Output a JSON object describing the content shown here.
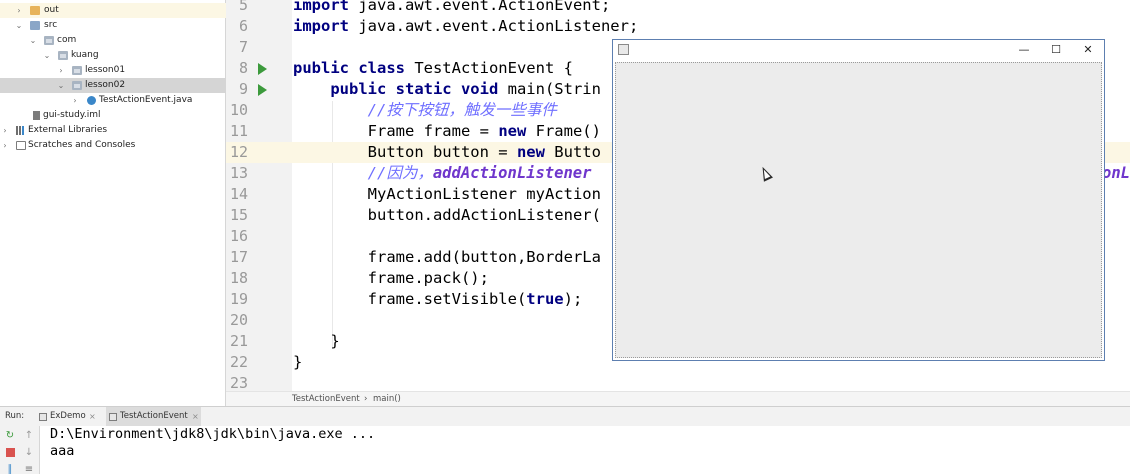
{
  "project_tree": {
    "items": [
      {
        "label": "out",
        "icon": "folder-orange-icon"
      },
      {
        "label": "src",
        "icon": "source-folder-icon"
      },
      {
        "label": "com",
        "icon": "package-icon"
      },
      {
        "label": "kuang",
        "icon": "package-icon"
      },
      {
        "label": "lesson01",
        "icon": "package-icon"
      },
      {
        "label": "lesson02",
        "icon": "package-icon"
      },
      {
        "label": "TestActionEvent.java",
        "icon": "java-class-icon"
      },
      {
        "label": "gui-study.iml",
        "icon": "iml-file-icon"
      },
      {
        "label": "External Libraries",
        "icon": "libraries-icon"
      },
      {
        "label": "Scratches and Consoles",
        "icon": "scratches-icon"
      }
    ]
  },
  "editor": {
    "current_line": 12,
    "lines": [
      {
        "num": "5",
        "segments": [
          {
            "t": "import",
            "c": "kw"
          },
          {
            "t": " java.awt.event.ActionEvent;",
            "c": ""
          }
        ]
      },
      {
        "num": "6",
        "segments": [
          {
            "t": "import",
            "c": "kw"
          },
          {
            "t": " java.awt.event.ActionListener;",
            "c": ""
          }
        ]
      },
      {
        "num": "7",
        "segments": []
      },
      {
        "num": "8",
        "segments": [
          {
            "t": "public class",
            "c": "kw"
          },
          {
            "t": " TestActionEvent {",
            "c": ""
          }
        ]
      },
      {
        "num": "9",
        "segments": [
          {
            "t": "    ",
            "c": ""
          },
          {
            "t": "public static void",
            "c": "kw"
          },
          {
            "t": " main(Strin",
            "c": ""
          }
        ]
      },
      {
        "num": "10",
        "segments": [
          {
            "t": "        ",
            "c": ""
          },
          {
            "t": "//按下按钮，触发一些事件",
            "c": "cm"
          }
        ]
      },
      {
        "num": "11",
        "segments": [
          {
            "t": "        Frame frame = ",
            "c": ""
          },
          {
            "t": "new",
            "c": "kw"
          },
          {
            "t": " Frame()",
            "c": ""
          }
        ]
      },
      {
        "num": "12",
        "segments": [
          {
            "t": "        Button button = ",
            "c": ""
          },
          {
            "t": "new",
            "c": "kw"
          },
          {
            "t": " Butto",
            "c": ""
          }
        ]
      },
      {
        "num": "13",
        "segments": [
          {
            "t": "        ",
            "c": ""
          },
          {
            "t": "//因为，",
            "c": "cm"
          },
          {
            "t": "addActionListener",
            "c": "cm-b"
          }
        ]
      },
      {
        "num": "14",
        "segments": [
          {
            "t": "        MyActionListener myAction",
            "c": ""
          }
        ]
      },
      {
        "num": "15",
        "segments": [
          {
            "t": "        button.addActionListener(",
            "c": ""
          }
        ]
      },
      {
        "num": "16",
        "segments": []
      },
      {
        "num": "17",
        "segments": [
          {
            "t": "        frame.add(button,BorderLa",
            "c": ""
          }
        ]
      },
      {
        "num": "18",
        "segments": [
          {
            "t": "        frame.pack();",
            "c": ""
          }
        ]
      },
      {
        "num": "19",
        "segments": [
          {
            "t": "        frame.setVisible(",
            "c": ""
          },
          {
            "t": "true",
            "c": "kw"
          },
          {
            "t": ");",
            "c": ""
          }
        ]
      },
      {
        "num": "20",
        "segments": []
      },
      {
        "num": "21",
        "segments": [
          {
            "t": "    }",
            "c": ""
          }
        ]
      },
      {
        "num": "22",
        "segments": [
          {
            "t": "}",
            "c": ""
          }
        ]
      },
      {
        "num": "23",
        "segments": []
      }
    ],
    "overflow_text_line13": "onL"
  },
  "breadcrumb": {
    "class_name": "TestActionEvent",
    "separator": "›",
    "method_name": "main()"
  },
  "run_panel": {
    "title": "Run:",
    "tabs": [
      {
        "label": "ExDemo",
        "close": "×"
      },
      {
        "label": "TestActionEvent",
        "close": "×"
      }
    ],
    "console_lines": [
      "D:\\Environment\\jdk8\\jdk\\bin\\java.exe ...",
      "aaa"
    ]
  },
  "awt_frame": {
    "minimize_glyph": "—",
    "maximize_glyph": "☐",
    "close_glyph": "✕"
  },
  "colors": {
    "keyword": "#000080",
    "comment": "#6f6fff",
    "current_line": "#fcf7e4",
    "run_green": "#3c9a3c"
  }
}
